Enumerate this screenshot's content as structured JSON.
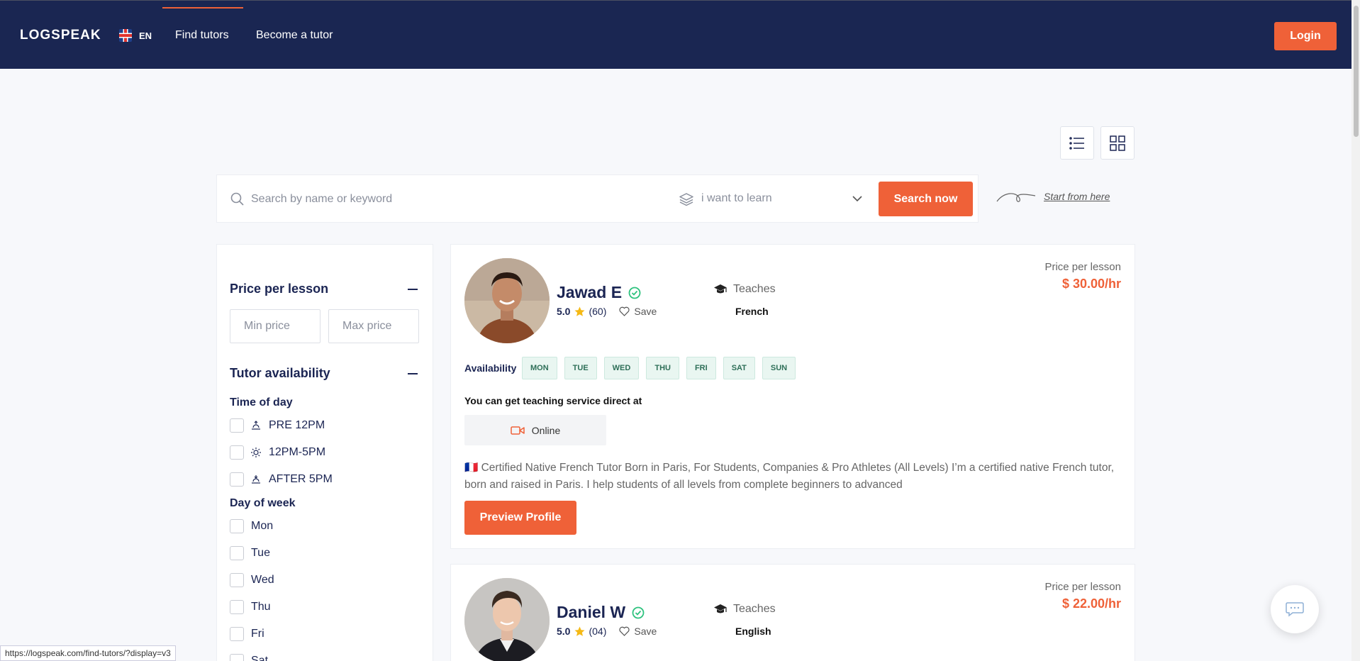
{
  "header": {
    "logo": "LOGSPEAK",
    "language": "EN",
    "nav": [
      "Find tutors",
      "Become a tutor"
    ],
    "login_label": "Login"
  },
  "search": {
    "placeholder": "Search by name or keyword",
    "learn_placeholder": "i want to learn",
    "button_label": "Search now",
    "hint": "Start from here"
  },
  "filters": {
    "price_title": "Price per lesson",
    "min_placeholder": "Min price",
    "max_placeholder": "Max price",
    "availability_title": "Tutor availability",
    "time_of_day_title": "Time of day",
    "times": [
      "PRE 12PM",
      "12PM-5PM",
      "AFTER 5PM"
    ],
    "day_of_week_title": "Day of week",
    "days": [
      "Mon",
      "Tue",
      "Wed",
      "Thu",
      "Fri",
      "Sat"
    ]
  },
  "tutors": [
    {
      "name": "Jawad E",
      "rating": "5.0",
      "reviews": "(60)",
      "save_label": "Save",
      "teaches_label": "Teaches",
      "language": "French",
      "price_label": "Price per lesson",
      "price": "$ 30.00/hr",
      "availability_label": "Availability",
      "days": [
        "MON",
        "TUE",
        "WED",
        "THU",
        "FRI",
        "SAT",
        "SUN"
      ],
      "service_label": "You can get teaching service direct at",
      "service": "Online",
      "description": "🇫🇷 Certified Native French Tutor Born in Paris, For Students, Companies & Pro Athletes (All Levels) I’m a certified native French tutor, born and raised in Paris. I help students of all levels from complete beginners to advanced",
      "preview_label": "Preview Profile"
    },
    {
      "name": "Daniel W",
      "rating": "5.0",
      "reviews": "(04)",
      "save_label": "Save",
      "teaches_label": "Teaches",
      "language": "English",
      "price_label": "Price per lesson",
      "price": "$ 22.00/hr"
    }
  ],
  "status_bar": "https://logspeak.com/find-tutors/?display=v3",
  "colors": {
    "navy": "#1a2652",
    "accent": "#ef6138",
    "verified": "#2ec27e"
  }
}
